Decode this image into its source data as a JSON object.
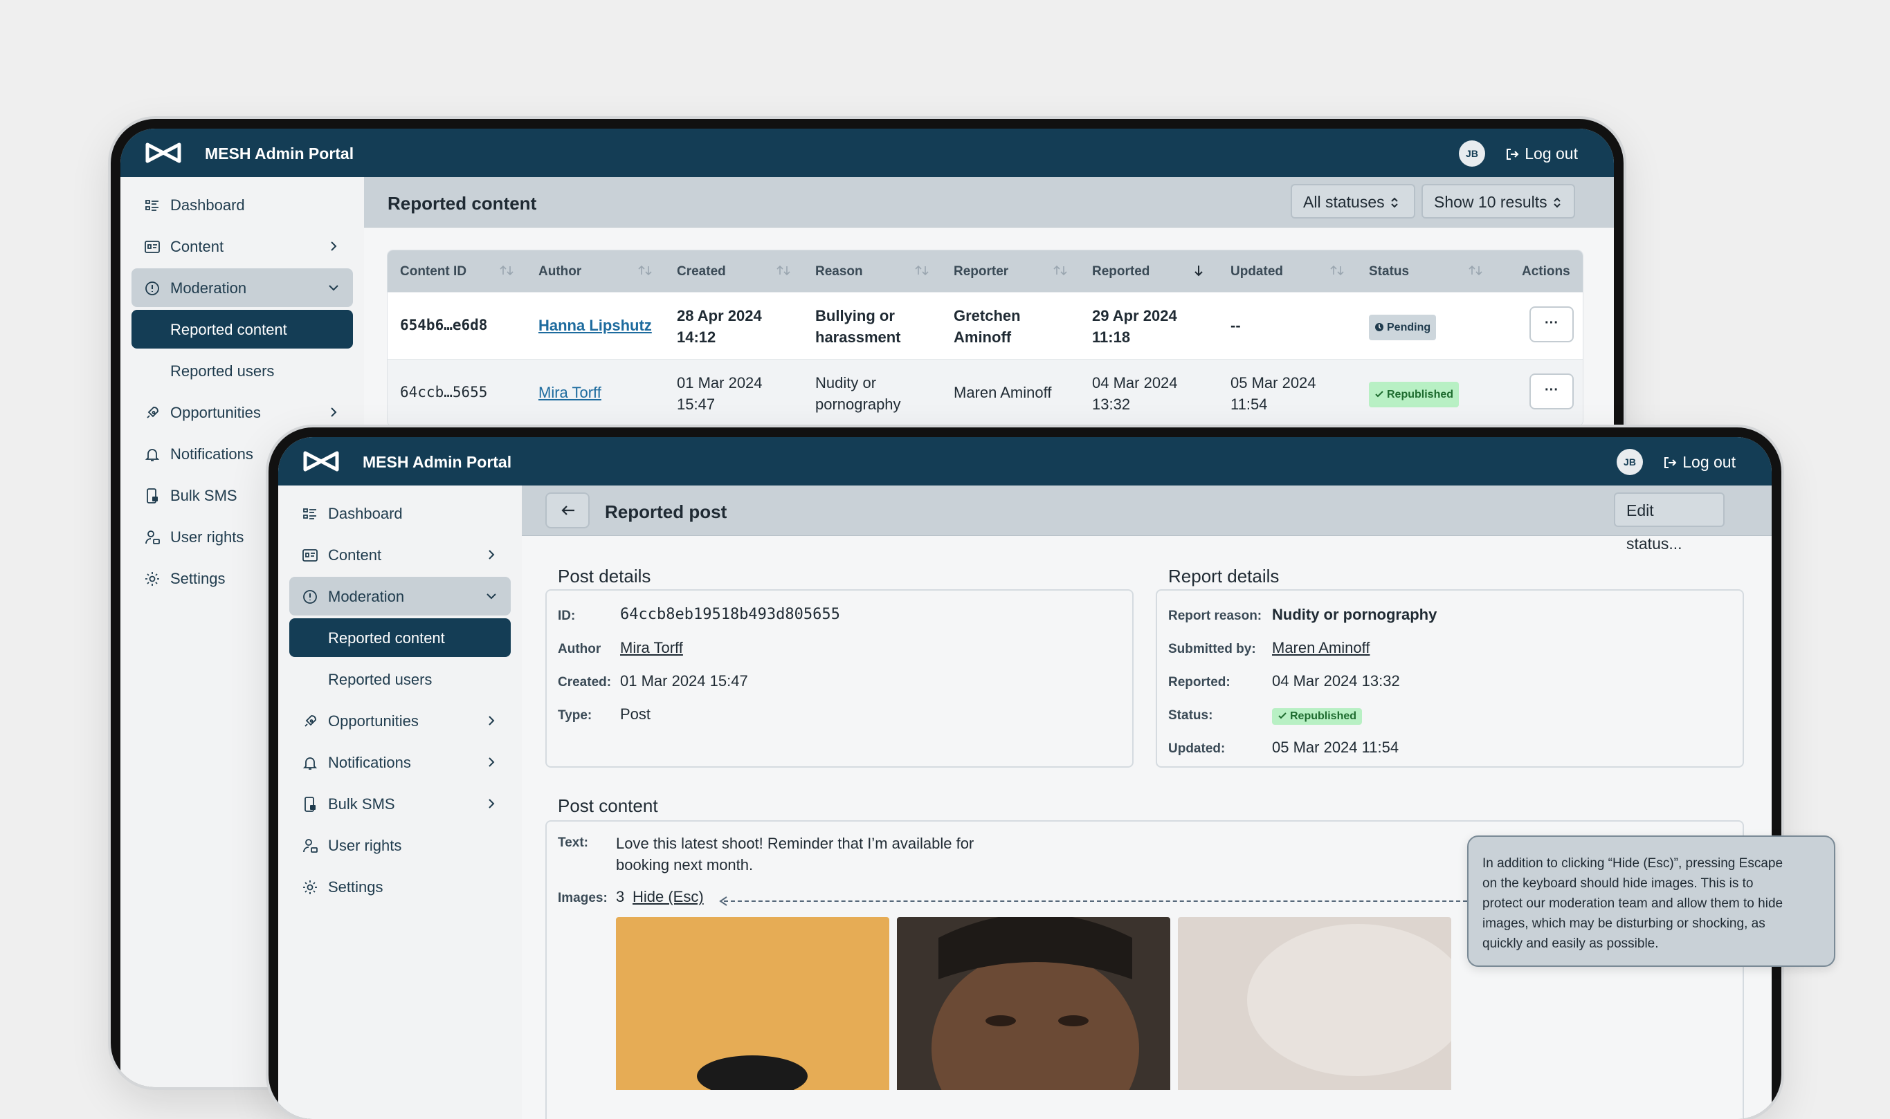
{
  "app": {
    "title": "MESH Admin Portal",
    "avatar_initials": "JB",
    "logout_label": "Log out"
  },
  "sidebar": {
    "items": [
      {
        "label": "Dashboard",
        "icon": "dashboard-icon"
      },
      {
        "label": "Content",
        "icon": "content-icon"
      },
      {
        "label": "Moderation",
        "icon": "moderation-icon"
      },
      {
        "label": "Reported content"
      },
      {
        "label": "Reported users"
      },
      {
        "label": "Opportunities",
        "icon": "rocket-icon"
      },
      {
        "label": "Notifications",
        "icon": "bell-icon"
      },
      {
        "label": "Bulk SMS",
        "icon": "sms-icon"
      },
      {
        "label": "User rights",
        "icon": "user-lock-icon"
      },
      {
        "label": "Settings",
        "icon": "gear-icon"
      }
    ]
  },
  "list_screen": {
    "title": "Reported content",
    "status_filter": "All statuses",
    "results_select": "Show 10 results",
    "columns": [
      "Content ID",
      "Author",
      "Created",
      "Reason",
      "Reporter",
      "Reported",
      "Updated",
      "Status",
      "Actions"
    ],
    "rows": [
      {
        "content_id": "654b6…e6d8",
        "author": "Hanna Lipshutz",
        "created_1": "28 Apr 2024",
        "created_2": "14:12",
        "reason_1": "Bullying or",
        "reason_2": "harassment",
        "reporter_1": "Gretchen",
        "reporter_2": "Aminoff",
        "reported_1": "29 Apr 2024",
        "reported_2": "11:18",
        "updated_1": "--",
        "updated_2": "",
        "status": "Pending",
        "action": "···"
      },
      {
        "content_id": "64ccb…5655",
        "author": "Mira Torff",
        "created_1": "01 Mar 2024",
        "created_2": "15:47",
        "reason_1": "Nudity or",
        "reason_2": "pornography",
        "reporter_1": "Maren Aminoff",
        "reporter_2": "",
        "reported_1": "04 Mar 2024",
        "reported_2": "13:32",
        "updated_1": "05 Mar 2024",
        "updated_2": "11:54",
        "status": "Republished",
        "action": "···"
      }
    ]
  },
  "detail_screen": {
    "title": "Reported post",
    "edit_status_label": "Edit status...",
    "post_details": {
      "heading": "Post details",
      "id_label": "ID:",
      "id_value": "64ccb8eb19518b493d805655",
      "author_label": "Author",
      "author_value": "Mira Torff",
      "created_label": "Created:",
      "created_value": "01 Mar 2024 15:47",
      "type_label": "Type:",
      "type_value": "Post"
    },
    "report_details": {
      "heading": "Report details",
      "reason_label": "Report reason:",
      "reason_value": "Nudity or pornography",
      "submitted_label": "Submitted by:",
      "submitted_value": "Maren Aminoff",
      "reported_label": "Reported:",
      "reported_value": "04 Mar 2024 13:32",
      "status_label": "Status:",
      "status_value": "Republished",
      "updated_label": "Updated:",
      "updated_value": "05 Mar 2024 11:54"
    },
    "post_content": {
      "heading": "Post content",
      "text_label": "Text:",
      "text_line1": "Love this latest shoot! Reminder that I’m available for",
      "text_line2": "booking next month.",
      "images_label": "Images:",
      "images_count": "3",
      "hide_link": "Hide (Esc)"
    }
  },
  "callout": {
    "line1": "In addition to clicking “Hide (Esc)”, pressing Escape",
    "line2": "on the keyboard should hide images. This is to",
    "line3": "protect our moderation team and allow them to hide",
    "line4": "images, which may be disturbing or shocking, as",
    "line5": "quickly and easily as possible."
  },
  "colors": {
    "brand": "#143d55",
    "link": "#1d6b9e",
    "success_bg": "#b8f0c4"
  }
}
